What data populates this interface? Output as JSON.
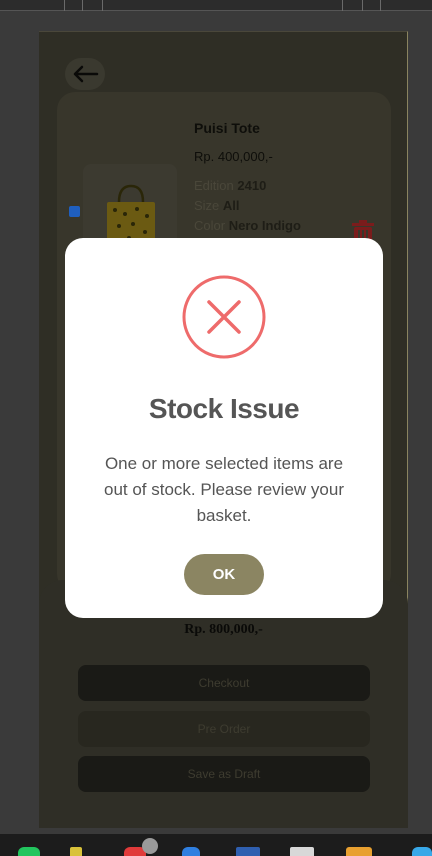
{
  "screen": {
    "back_icon": "arrow-left-icon"
  },
  "product": {
    "name": "Puisi Tote",
    "price": "Rp. 400,000,-",
    "edition_label": "Edition",
    "edition_value": "2410",
    "size_label": "Size",
    "size_value": "All",
    "color_label": "Color",
    "color_value": "Nero Indigo",
    "selected": true,
    "delete_icon": "trash-icon"
  },
  "footer": {
    "total": "Rp.  800,000,-",
    "checkout_label": "Checkout",
    "preorder_label": "Pre Order",
    "draft_label": "Save as Draft"
  },
  "modal": {
    "icon": "x-circle-icon",
    "title": "Stock Issue",
    "message": "One or more selected items are out of stock. Please review your basket.",
    "ok_label": "OK",
    "accent": "#ee6b6b",
    "button_color": "#8b8562"
  }
}
